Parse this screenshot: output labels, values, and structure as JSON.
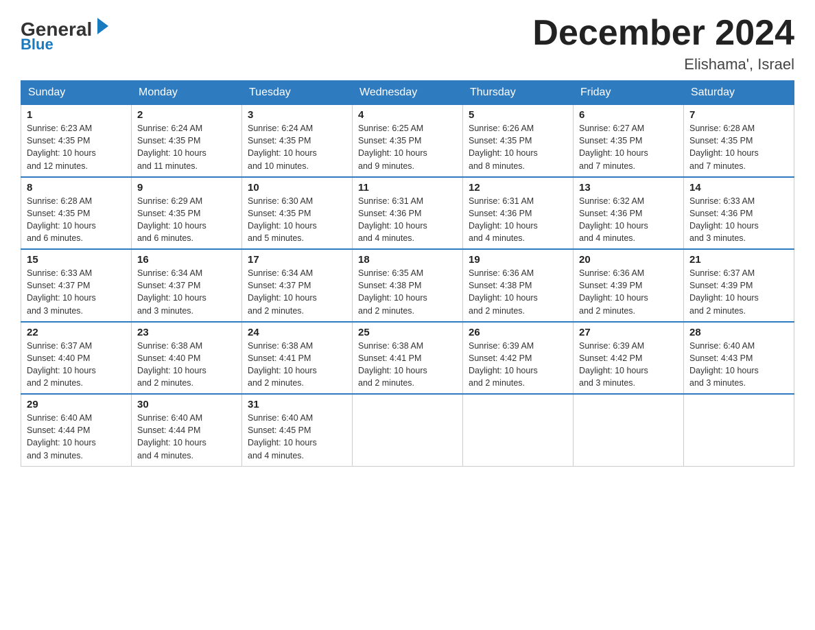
{
  "logo": {
    "general": "General",
    "blue": "Blue"
  },
  "title": {
    "month": "December 2024",
    "location": "Elishama', Israel"
  },
  "days_of_week": [
    "Sunday",
    "Monday",
    "Tuesday",
    "Wednesday",
    "Thursday",
    "Friday",
    "Saturday"
  ],
  "weeks": [
    [
      {
        "day": "1",
        "sunrise": "6:23 AM",
        "sunset": "4:35 PM",
        "daylight": "10 hours and 12 minutes."
      },
      {
        "day": "2",
        "sunrise": "6:24 AM",
        "sunset": "4:35 PM",
        "daylight": "10 hours and 11 minutes."
      },
      {
        "day": "3",
        "sunrise": "6:24 AM",
        "sunset": "4:35 PM",
        "daylight": "10 hours and 10 minutes."
      },
      {
        "day": "4",
        "sunrise": "6:25 AM",
        "sunset": "4:35 PM",
        "daylight": "10 hours and 9 minutes."
      },
      {
        "day": "5",
        "sunrise": "6:26 AM",
        "sunset": "4:35 PM",
        "daylight": "10 hours and 8 minutes."
      },
      {
        "day": "6",
        "sunrise": "6:27 AM",
        "sunset": "4:35 PM",
        "daylight": "10 hours and 7 minutes."
      },
      {
        "day": "7",
        "sunrise": "6:28 AM",
        "sunset": "4:35 PM",
        "daylight": "10 hours and 7 minutes."
      }
    ],
    [
      {
        "day": "8",
        "sunrise": "6:28 AM",
        "sunset": "4:35 PM",
        "daylight": "10 hours and 6 minutes."
      },
      {
        "day": "9",
        "sunrise": "6:29 AM",
        "sunset": "4:35 PM",
        "daylight": "10 hours and 6 minutes."
      },
      {
        "day": "10",
        "sunrise": "6:30 AM",
        "sunset": "4:35 PM",
        "daylight": "10 hours and 5 minutes."
      },
      {
        "day": "11",
        "sunrise": "6:31 AM",
        "sunset": "4:36 PM",
        "daylight": "10 hours and 4 minutes."
      },
      {
        "day": "12",
        "sunrise": "6:31 AM",
        "sunset": "4:36 PM",
        "daylight": "10 hours and 4 minutes."
      },
      {
        "day": "13",
        "sunrise": "6:32 AM",
        "sunset": "4:36 PM",
        "daylight": "10 hours and 4 minutes."
      },
      {
        "day": "14",
        "sunrise": "6:33 AM",
        "sunset": "4:36 PM",
        "daylight": "10 hours and 3 minutes."
      }
    ],
    [
      {
        "day": "15",
        "sunrise": "6:33 AM",
        "sunset": "4:37 PM",
        "daylight": "10 hours and 3 minutes."
      },
      {
        "day": "16",
        "sunrise": "6:34 AM",
        "sunset": "4:37 PM",
        "daylight": "10 hours and 3 minutes."
      },
      {
        "day": "17",
        "sunrise": "6:34 AM",
        "sunset": "4:37 PM",
        "daylight": "10 hours and 2 minutes."
      },
      {
        "day": "18",
        "sunrise": "6:35 AM",
        "sunset": "4:38 PM",
        "daylight": "10 hours and 2 minutes."
      },
      {
        "day": "19",
        "sunrise": "6:36 AM",
        "sunset": "4:38 PM",
        "daylight": "10 hours and 2 minutes."
      },
      {
        "day": "20",
        "sunrise": "6:36 AM",
        "sunset": "4:39 PM",
        "daylight": "10 hours and 2 minutes."
      },
      {
        "day": "21",
        "sunrise": "6:37 AM",
        "sunset": "4:39 PM",
        "daylight": "10 hours and 2 minutes."
      }
    ],
    [
      {
        "day": "22",
        "sunrise": "6:37 AM",
        "sunset": "4:40 PM",
        "daylight": "10 hours and 2 minutes."
      },
      {
        "day": "23",
        "sunrise": "6:38 AM",
        "sunset": "4:40 PM",
        "daylight": "10 hours and 2 minutes."
      },
      {
        "day": "24",
        "sunrise": "6:38 AM",
        "sunset": "4:41 PM",
        "daylight": "10 hours and 2 minutes."
      },
      {
        "day": "25",
        "sunrise": "6:38 AM",
        "sunset": "4:41 PM",
        "daylight": "10 hours and 2 minutes."
      },
      {
        "day": "26",
        "sunrise": "6:39 AM",
        "sunset": "4:42 PM",
        "daylight": "10 hours and 2 minutes."
      },
      {
        "day": "27",
        "sunrise": "6:39 AM",
        "sunset": "4:42 PM",
        "daylight": "10 hours and 3 minutes."
      },
      {
        "day": "28",
        "sunrise": "6:40 AM",
        "sunset": "4:43 PM",
        "daylight": "10 hours and 3 minutes."
      }
    ],
    [
      {
        "day": "29",
        "sunrise": "6:40 AM",
        "sunset": "4:44 PM",
        "daylight": "10 hours and 3 minutes."
      },
      {
        "day": "30",
        "sunrise": "6:40 AM",
        "sunset": "4:44 PM",
        "daylight": "10 hours and 4 minutes."
      },
      {
        "day": "31",
        "sunrise": "6:40 AM",
        "sunset": "4:45 PM",
        "daylight": "10 hours and 4 minutes."
      },
      null,
      null,
      null,
      null
    ]
  ],
  "labels": {
    "sunrise": "Sunrise:",
    "sunset": "Sunset:",
    "daylight": "Daylight:"
  }
}
